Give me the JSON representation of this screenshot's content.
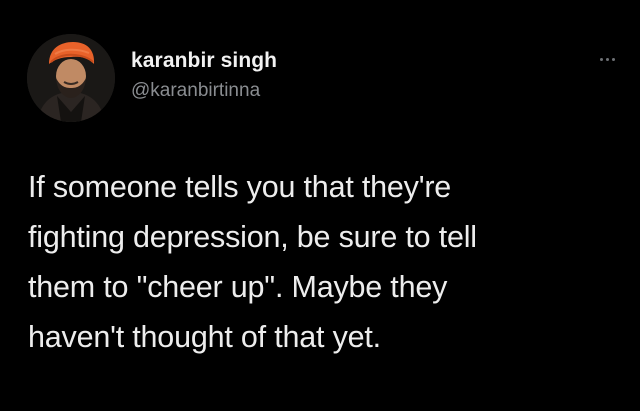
{
  "tweet": {
    "author": {
      "display_name": "karanbir singh",
      "handle": "@karanbirtinna",
      "avatar_icon": "profile-photo",
      "avatar_turban_color": "#e8622a",
      "avatar_bg_color": "#1c1c1c"
    },
    "more_icon": "ellipsis-icon",
    "text_lines": [
      "If someone tells you that they're",
      "fighting depression, be sure to tell",
      "them to \"cheer up\". Maybe they",
      "haven't thought of that yet."
    ]
  },
  "theme": {
    "background": "#000000",
    "text_color": "#ededed",
    "secondary_text_color": "#8a8d91"
  }
}
